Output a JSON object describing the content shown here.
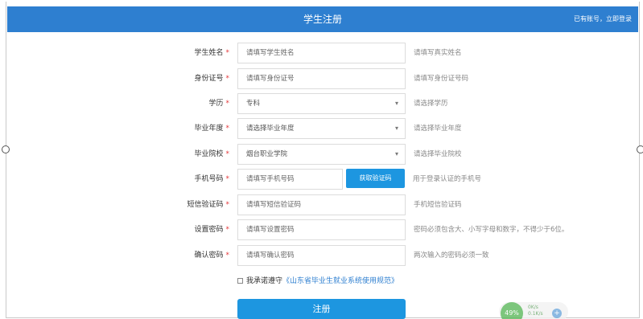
{
  "header": {
    "title": "学生注册",
    "login_prompt": "已有账号，",
    "login_link": "立即登录"
  },
  "form": {
    "required_mark": "*",
    "fields": [
      {
        "label": "学生姓名",
        "placeholder": "请填写学生姓名",
        "hint": "请填写真实姓名"
      },
      {
        "label": "身份证号",
        "placeholder": "请填写身份证号",
        "hint": "请填写身份证号码"
      },
      {
        "label": "学历",
        "value": "专科",
        "hint": "请选择学历"
      },
      {
        "label": "毕业年度",
        "value": "请选择毕业年度",
        "hint": "请选择毕业年度"
      },
      {
        "label": "毕业院校",
        "value": "烟台职业学院",
        "hint": "请选择毕业院校"
      },
      {
        "label": "手机号码",
        "placeholder": "请填写手机号码",
        "hint": "用于登录认证的手机号",
        "button": "获取验证码"
      },
      {
        "label": "短信验证码",
        "placeholder": "请填写短信验证码",
        "hint": "手机短信验证码"
      },
      {
        "label": "设置密码",
        "placeholder": "请填写设置密码",
        "hint": "密码必须包含大、小写字母和数字，不得少于6位。"
      },
      {
        "label": "确认密码",
        "placeholder": "请填写确认密码",
        "hint": "两次输入的密码必须一致"
      }
    ],
    "agreement_prefix": "我承诺遵守",
    "agreement_link": "《山东省毕业生就业系统使用规范》",
    "submit_label": "注册"
  },
  "widget": {
    "percent": "49%",
    "speed_up": "0K/s",
    "speed_down": "0.1K/s",
    "plus": "+"
  }
}
